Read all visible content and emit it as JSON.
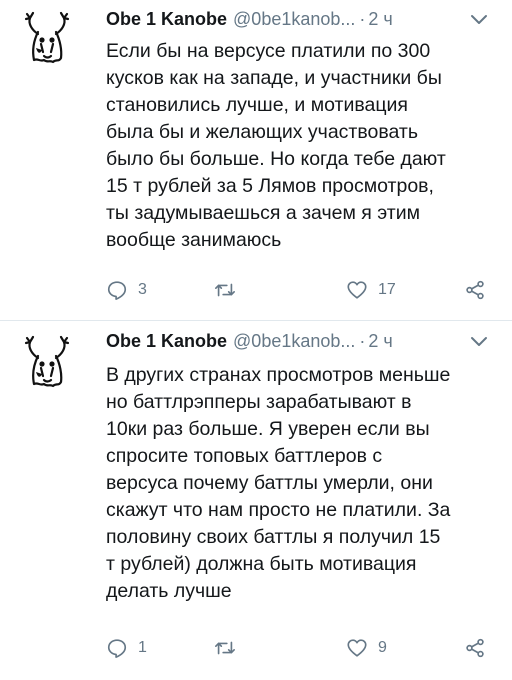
{
  "colors": {
    "text": "#14171a",
    "muted": "#657786",
    "border": "#e1e8ed"
  },
  "icons": {
    "avatar": "hand-drawn-ghost-avatar",
    "menu": "chevron-down-icon",
    "reply": "reply-bubble-icon",
    "retweet": "retweet-icon",
    "like": "heart-icon",
    "share": "share-nodes-icon"
  },
  "tweets": [
    {
      "name": "Obe 1 Kanobe",
      "handle": "@0be1kanob...",
      "dot": "·",
      "time": "2 ч",
      "lines": [
        "Если бы на версусе платили по 300",
        "кусков как на западе, и участники бы",
        "становились лучше, и мотивация",
        "была бы и желающих участвовать",
        "было бы больше. Но когда тебе дают",
        "15 т рублей за 5 Лямов просмотров,",
        "ты задумываешься а зачем я этим",
        "вообще занимаюсь"
      ],
      "replies": "3",
      "likes": "17"
    },
    {
      "name": "Obe 1 Kanobe",
      "handle": "@0be1kanob...",
      "dot": "·",
      "time": "2 ч",
      "lines": [
        "В других странах просмотров меньше",
        "но баттлрэпперы зарабатывают в",
        "10ки раз больше. Я уверен если вы",
        "спросите топовых баттлеров с",
        "версуса почему баттлы умерли, они",
        "скажут что нам просто не платили. За",
        "половину своих баттлы я получил 15",
        "т рублей) должна быть мотивация",
        "делать лучше"
      ],
      "replies": "1",
      "likes": "9"
    }
  ]
}
